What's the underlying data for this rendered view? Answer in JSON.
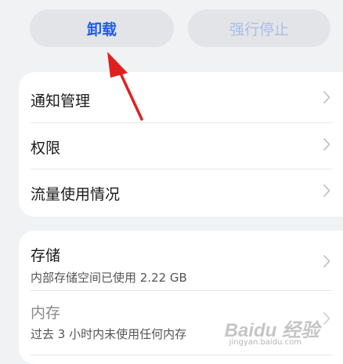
{
  "actions": {
    "uninstall_label": "卸载",
    "force_stop_label": "强行停止"
  },
  "settings_card": {
    "items": [
      {
        "label": "通知管理"
      },
      {
        "label": "权限"
      },
      {
        "label": "流量使用情况"
      }
    ]
  },
  "storage_card": {
    "storage_title": "存储",
    "storage_sub": "内部存储空间已使用 2.22 GB",
    "memory_title": "内存",
    "memory_sub": "过去 3 小时内未使用任何内存"
  },
  "watermark": {
    "brand": "Baidu 经验",
    "url": "jingyan.baidu.com"
  },
  "colors": {
    "accent": "#1e5de4",
    "disabled_accent": "#a9bde9",
    "annotation_arrow": "#e02020"
  }
}
